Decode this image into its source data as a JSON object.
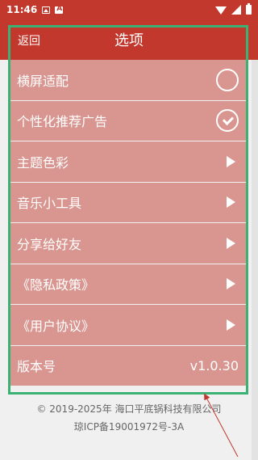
{
  "status_bar": {
    "time": "11:46",
    "icons": [
      "gallery-icon",
      "alert-icon",
      "wifi-icon",
      "signal-icon",
      "battery-icon"
    ]
  },
  "header": {
    "back_label": "返回",
    "title": "选项",
    "background": "#c2382d"
  },
  "options": [
    {
      "label": "横屏适配",
      "control": "circle-icon",
      "state": "unchecked"
    },
    {
      "label": "个性化推荐广告",
      "control": "check-icon",
      "state": "checked"
    },
    {
      "label": "主题色彩",
      "control": "arrow-icon"
    },
    {
      "label": "音乐小工具",
      "control": "arrow-icon"
    },
    {
      "label": "分享给好友",
      "control": "arrow-icon"
    },
    {
      "label": "《隐私政策》",
      "control": "arrow-icon"
    },
    {
      "label": "《用户协议》",
      "control": "arrow-icon"
    }
  ],
  "version": {
    "label": "版本号",
    "value": "v1.0.30"
  },
  "footer": {
    "copyright": "© 2019-2025年 海口平底锅科技有限公司",
    "icp": "琼ICP备19001972号-3A"
  },
  "colors": {
    "accent": "#c2382d",
    "row_background": "#d9958f",
    "highlight": "#3bb273"
  }
}
